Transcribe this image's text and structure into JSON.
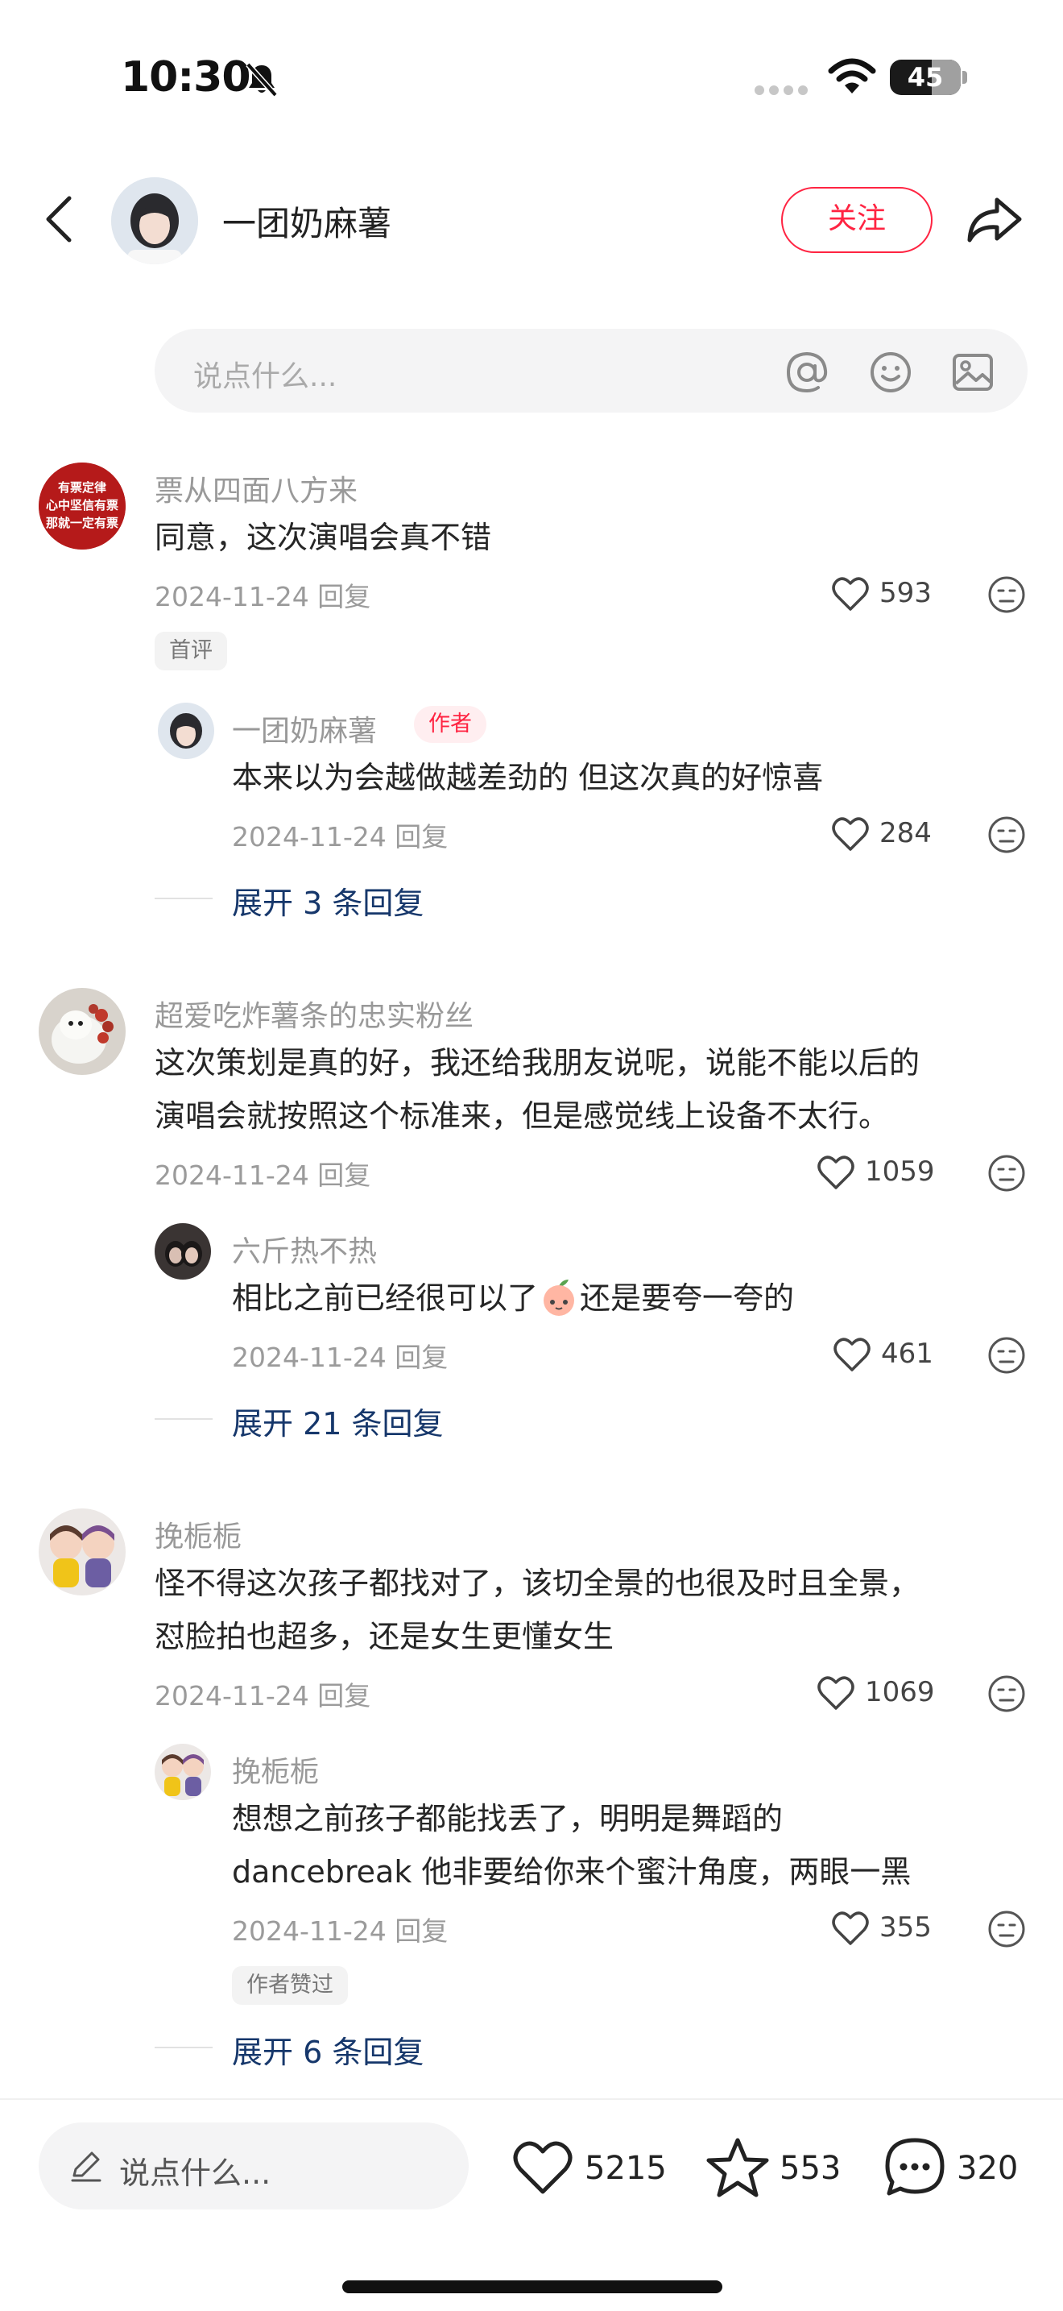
{
  "status_bar": {
    "time": "10:30",
    "battery": "45"
  },
  "header": {
    "author_name": "一团奶麻薯",
    "follow_label": "关注"
  },
  "top_input": {
    "placeholder": "说点什么..."
  },
  "comments": [
    {
      "user": "票从四面八方来",
      "avatar_text": [
        "有票定律",
        "心中坚信有票",
        "那就一定有票"
      ],
      "text_lines": [
        "同意，这次演唱会真不错"
      ],
      "date": "2024-11-24",
      "reply_label": "回复",
      "likes": "593",
      "tag": "首评",
      "reply": {
        "user": "一团奶麻薯",
        "author_tag": "作者",
        "text_lines": [
          "本来以为会越做越差劲的 但这次真的好惊喜"
        ],
        "date": "2024-11-24",
        "reply_label": "回复",
        "likes": "284"
      },
      "expand_label": "展开 3 条回复"
    },
    {
      "user": "超爱吃炸薯条的忠实粉丝",
      "text_lines": [
        "这次策划是真的好，我还给我朋友说呢，说能不能以后的",
        "演唱会就按照这个标准来，但是感觉线上设备不太行。"
      ],
      "date": "2024-11-24",
      "reply_label": "回复",
      "likes": "1059",
      "reply": {
        "user": "六斤热不热",
        "text_before": "相比之前已经很可以了",
        "text_after": "还是要夸一夸的",
        "date": "2024-11-24",
        "reply_label": "回复",
        "likes": "461"
      },
      "expand_label": "展开 21 条回复"
    },
    {
      "user": "挽栀栀",
      "text_lines": [
        "怪不得这次孩子都找对了，该切全景的也很及时且全景，",
        "怼脸拍也超多，还是女生更懂女生"
      ],
      "date": "2024-11-24",
      "reply_label": "回复",
      "likes": "1069",
      "reply": {
        "user": "挽栀栀",
        "text_lines": [
          "想想之前孩子都能找丢了，明明是舞蹈的",
          "dancebreak 他非要给你来个蜜汁角度，两眼一黑"
        ],
        "date": "2024-11-24",
        "reply_label": "回复",
        "likes": "355",
        "tag": "作者赞过"
      },
      "expand_label": "展开 6 条回复"
    }
  ],
  "bottom_bar": {
    "placeholder": "说点什么...",
    "likes": "5215",
    "stars": "553",
    "comments": "320"
  },
  "colors": {
    "accent": "#ff2442",
    "expand_link": "#16376b"
  }
}
